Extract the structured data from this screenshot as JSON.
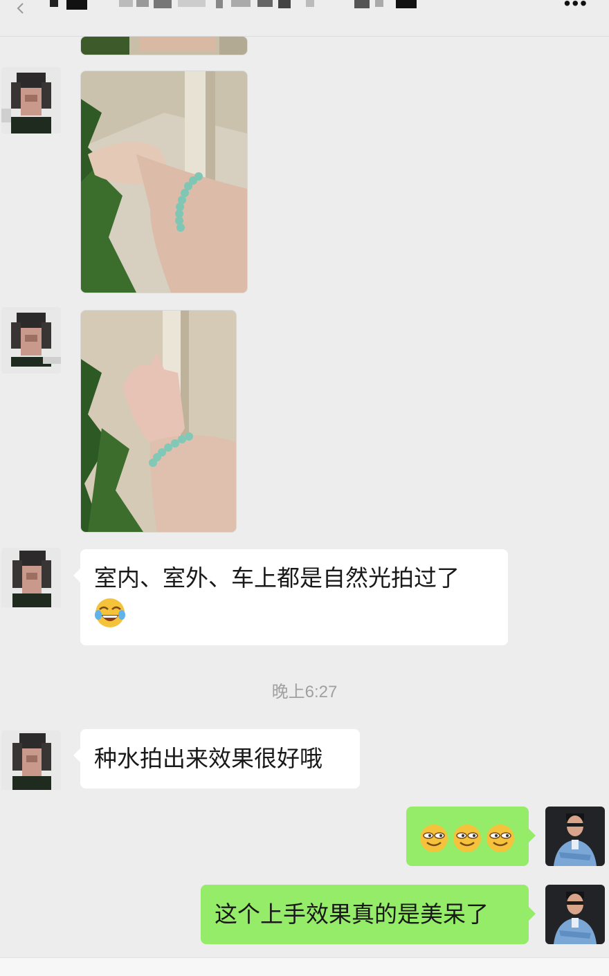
{
  "header": {
    "back_icon": "chevron-left-icon",
    "more_icon": "more-dots-icon",
    "more_label": "•••"
  },
  "messages": [
    {
      "type": "image",
      "side": "left",
      "description_icon": "photo-bracelet-partial"
    },
    {
      "type": "image",
      "side": "left",
      "description_icon": "photo-bracelet-wrist"
    },
    {
      "type": "image",
      "side": "left",
      "description_icon": "photo-bracelet-hand"
    },
    {
      "type": "text",
      "side": "left",
      "line1": "室内、室外、车上都是自然光拍过了",
      "emoji": "laughing-tears-emoji"
    },
    {
      "type": "text",
      "side": "left",
      "text": "种水拍出来效果很好哦"
    },
    {
      "type": "emoji",
      "side": "right",
      "emoji": "grinning-emoji",
      "count": 3
    },
    {
      "type": "text",
      "side": "right",
      "text": "这个上手效果真的是美呆了"
    }
  ],
  "timestamp": "晚上6:27",
  "colors": {
    "background": "#ededed",
    "bubble_left": "#ffffff",
    "bubble_right": "#95ec69",
    "timestamp": "#a0a0a0"
  }
}
